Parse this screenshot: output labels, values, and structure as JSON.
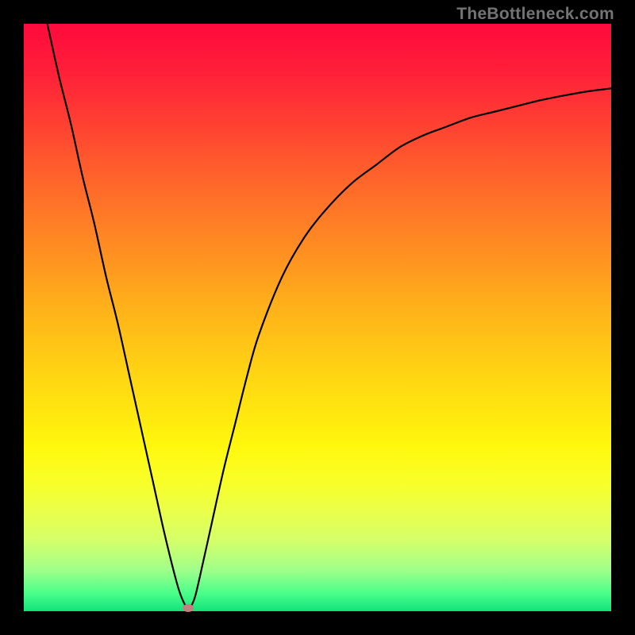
{
  "watermark": "TheBottleneck.com",
  "chart_data": {
    "type": "line",
    "title": "",
    "xlabel": "",
    "ylabel": "",
    "xlim": [
      0,
      100
    ],
    "ylim": [
      0,
      100
    ],
    "series": [
      {
        "name": "bottleneck-curve",
        "x": [
          4,
          6,
          8,
          10,
          12,
          14,
          16,
          18,
          20,
          22,
          24,
          26,
          27,
          28,
          29,
          30,
          32,
          34,
          36,
          38,
          40,
          44,
          48,
          52,
          56,
          60,
          64,
          68,
          72,
          76,
          80,
          84,
          88,
          92,
          96,
          100
        ],
        "y": [
          100,
          91,
          83,
          74,
          66,
          57,
          49,
          40,
          31,
          22,
          13,
          5,
          2,
          0.5,
          2,
          6,
          15,
          24,
          32,
          40,
          47,
          57,
          64,
          69,
          73,
          76,
          79,
          81,
          82.5,
          84,
          85,
          86,
          87,
          87.8,
          88.5,
          89
        ]
      }
    ],
    "annotations": [
      {
        "name": "minima-marker",
        "x": 28,
        "y": 0.5
      }
    ],
    "gradient_background": {
      "orientation": "vertical",
      "stops": [
        {
          "pos": 0.0,
          "color": "#ff0a3c"
        },
        {
          "pos": 0.5,
          "color": "#ffd014"
        },
        {
          "pos": 0.8,
          "color": "#f8ff28"
        },
        {
          "pos": 1.0,
          "color": "#12e27b"
        }
      ]
    }
  }
}
